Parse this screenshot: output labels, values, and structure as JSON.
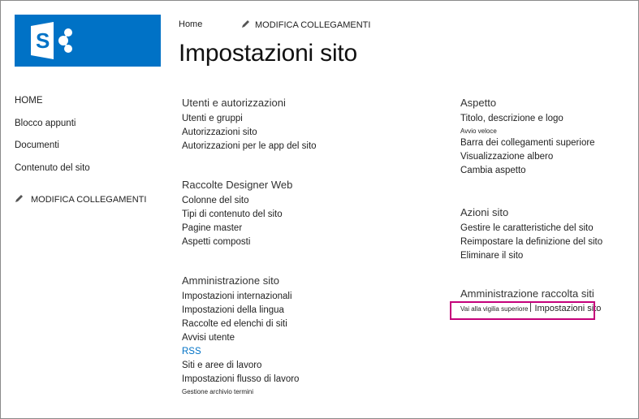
{
  "logo": {
    "icon": "sharepoint-logo-icon",
    "color": "#0072c6"
  },
  "topnav": {
    "home": "Home",
    "edit_links": "MODIFICA COLLEGAMENTI"
  },
  "page_title": "Impostazioni sito",
  "leftnav": {
    "items": [
      "HOME",
      "Blocco appunti",
      "Documenti",
      "Contenuto del sito"
    ],
    "edit_links": "MODIFICA COLLEGAMENTI"
  },
  "groups": {
    "users": {
      "title": "Utenti e autorizzazioni",
      "links": [
        "Utenti e gruppi",
        "Autorizzazioni sito",
        "Autorizzazioni per le app del sito"
      ]
    },
    "designer": {
      "title": "Raccolte Designer Web",
      "links": [
        "Colonne del sito",
        "Tipi di contenuto del sito",
        "Pagine master",
        "Aspetti composti"
      ]
    },
    "admin": {
      "title": "Amministrazione sito",
      "links": [
        "Impostazioni internazionali",
        "Impostazioni della lingua",
        "Raccolte ed elenchi di siti",
        "Avvisi utente",
        "RSS",
        "Siti e aree di lavoro",
        "Impostazioni flusso di lavoro",
        "Gestione archivio termini"
      ]
    },
    "look": {
      "title": "Aspetto",
      "links": [
        "Titolo, descrizione e logo",
        "Avvio veloce",
        "Barra dei collegamenti superiore",
        "Visualizzazione albero",
        "Cambia aspetto"
      ]
    },
    "actions": {
      "title": "Azioni sito",
      "links": [
        "Gestire le caratteristiche del sito",
        "Reimpostare la definizione del sito",
        "Eliminare il sito"
      ]
    },
    "collection": {
      "title": "Amministrazione raccolta siti",
      "top_level": "Vai alla vigilia superiore",
      "settings": "Impostazioni sito"
    }
  },
  "highlight_color": "#c4007a"
}
